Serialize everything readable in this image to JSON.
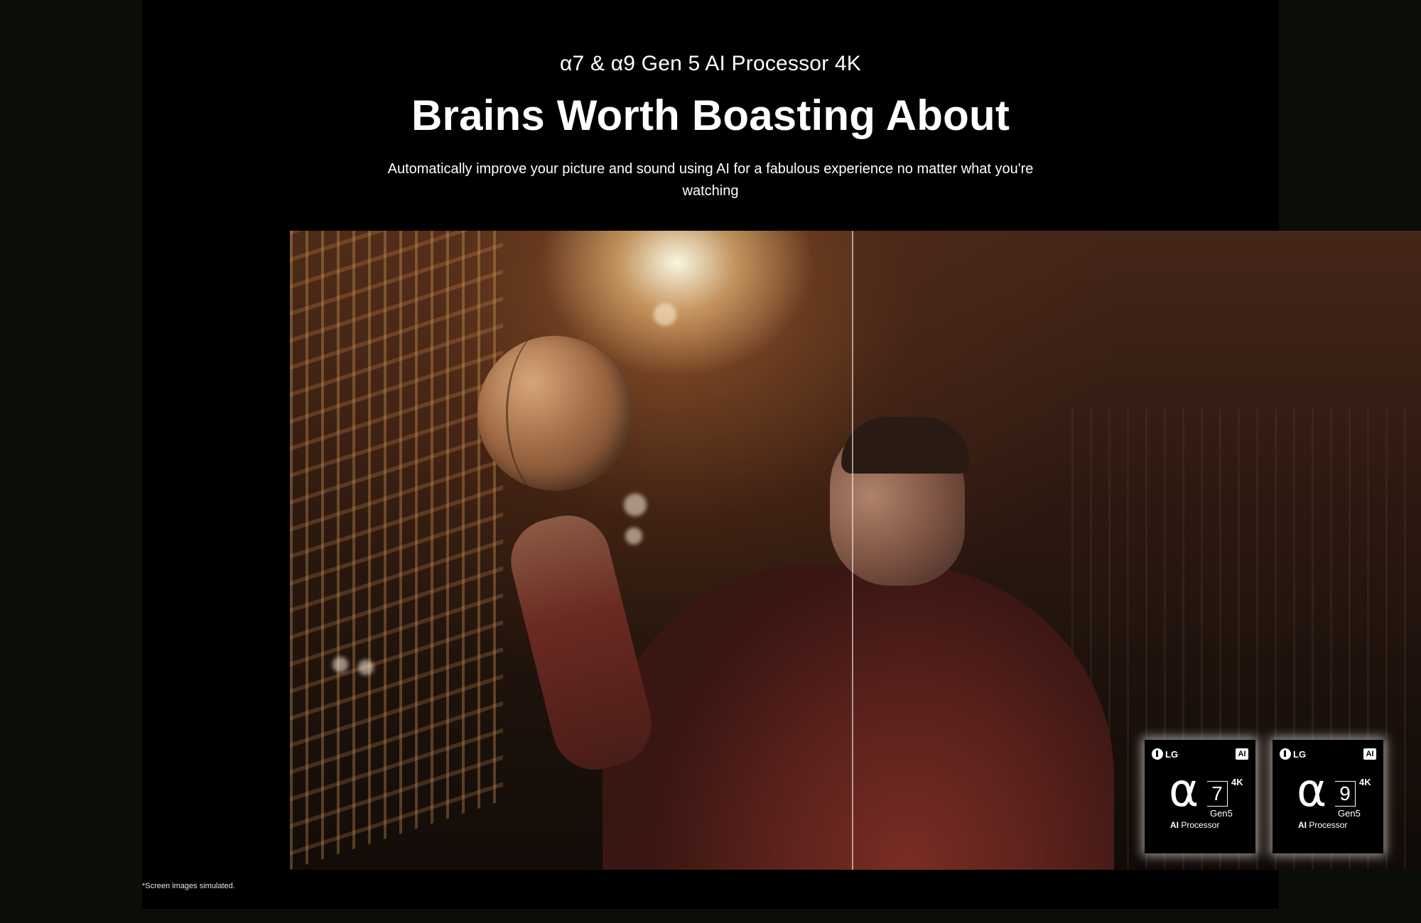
{
  "header": {
    "eyebrow": "α7 & α9 Gen 5 AI Processor 4K",
    "headline": "Brains Worth Boasting About",
    "description": "Automatically improve your picture and sound using AI for a fabulous experience no matter what you're watching"
  },
  "badges": [
    {
      "brand": "LG",
      "ai_tag": "AI",
      "alpha": "α",
      "number": "7",
      "resolution": "4K",
      "generation": "Gen5",
      "label_bold": "AI",
      "label_rest": " Processor"
    },
    {
      "brand": "LG",
      "ai_tag": "AI",
      "alpha": "α",
      "number": "9",
      "resolution": "4K",
      "generation": "Gen5",
      "label_bold": "AI",
      "label_rest": " Processor"
    }
  ],
  "footnote": "*Screen images simulated.",
  "colors": {
    "background": "#000000",
    "text": "#ffffff"
  }
}
